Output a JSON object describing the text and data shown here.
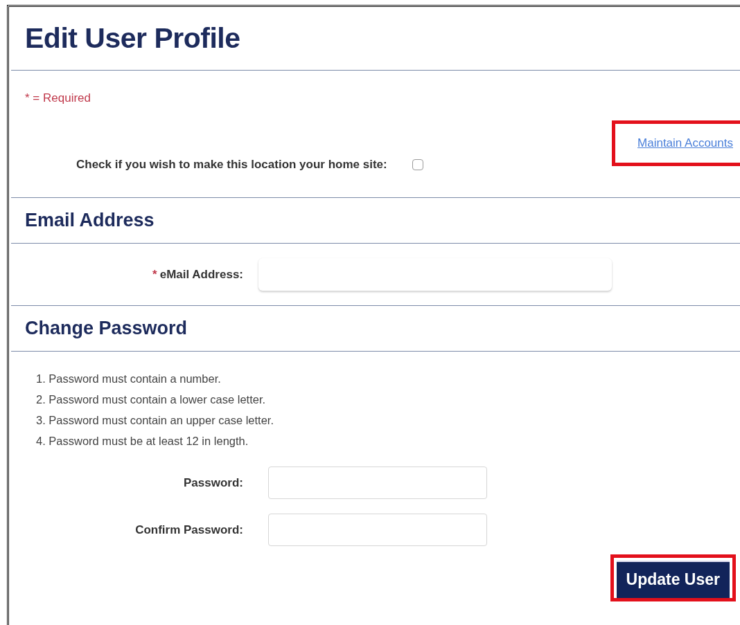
{
  "page": {
    "title": "Edit User Profile"
  },
  "required_note": "* = Required",
  "maintain_link": {
    "label": "Maintain Accounts",
    "highlighted": true
  },
  "home_site": {
    "label": "Check if you wish to make this location your home site:",
    "checked": false
  },
  "sections": [
    {
      "title": "Email Address",
      "fields": [
        {
          "label": "eMail Address:",
          "required_mark": "*",
          "kind": "email"
        }
      ]
    },
    {
      "title": "Change Password",
      "rules": [
        "1. Password must contain a number.",
        "2. Password must contain a lower case letter.",
        "3. Password must contain an upper case letter.",
        "4. Password must be at least 12 in length."
      ],
      "fields": [
        {
          "label": "Password:",
          "kind": "password"
        },
        {
          "label": "Confirm Password:",
          "kind": "password"
        }
      ]
    }
  ],
  "submit": {
    "label": "Update User",
    "highlighted": true
  }
}
